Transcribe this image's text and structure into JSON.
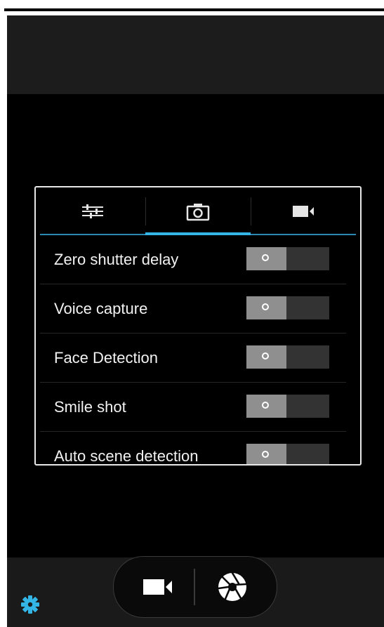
{
  "tabs": [
    {
      "name": "tab-general-settings",
      "icon": "sliders-icon",
      "active": false
    },
    {
      "name": "tab-camera-settings",
      "icon": "camera-icon",
      "active": true
    },
    {
      "name": "tab-video-settings",
      "icon": "video-camera-icon",
      "active": false
    }
  ],
  "settings": [
    {
      "label": "Zero shutter delay",
      "state": "off"
    },
    {
      "label": "Voice capture",
      "state": "off"
    },
    {
      "label": "Face Detection",
      "state": "off"
    },
    {
      "label": "Smile shot",
      "state": "off"
    },
    {
      "label": "Auto scene detection",
      "state": "off"
    }
  ],
  "controls": {
    "settings_icon": "gear-icon",
    "video_icon": "video-camera-icon",
    "shutter_icon": "shutter-icon"
  },
  "colors": {
    "accent": "#33b5e5",
    "settings_icon": "#33b5e5",
    "background": "#000000"
  }
}
